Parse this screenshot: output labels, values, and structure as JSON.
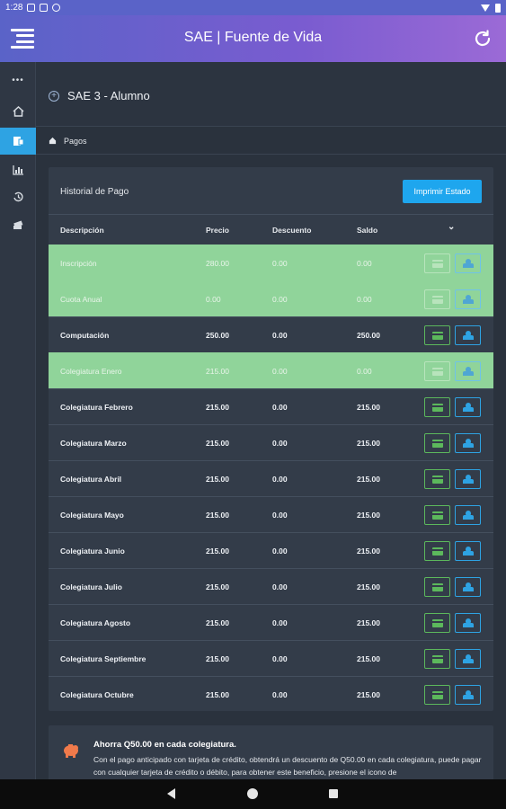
{
  "status": {
    "time": "1:28"
  },
  "app": {
    "title": "SAE | Fuente de Vida"
  },
  "sidebar": {
    "dots": "•••"
  },
  "page": {
    "title": "SAE 3 - Alumno",
    "breadcrumb": "Pagos"
  },
  "card": {
    "title": "Historial de Pago",
    "print_label": "Imprimir Estado",
    "columns": {
      "description": "Descripción",
      "price": "Precio",
      "discount": "Descuento",
      "balance": "Saldo",
      "expand": "⌄"
    },
    "rows": [
      {
        "description": "Inscripción",
        "price": "280.00",
        "discount": "0.00",
        "balance": "0.00",
        "paid": true
      },
      {
        "description": "Cuota Anual",
        "price": "0.00",
        "discount": "0.00",
        "balance": "0.00",
        "paid": true
      },
      {
        "description": "Computación",
        "price": "250.00",
        "discount": "0.00",
        "balance": "250.00",
        "paid": false
      },
      {
        "description": "Colegiatura Enero",
        "price": "215.00",
        "discount": "0.00",
        "balance": "0.00",
        "paid": true
      },
      {
        "description": "Colegiatura Febrero",
        "price": "215.00",
        "discount": "0.00",
        "balance": "215.00",
        "paid": false
      },
      {
        "description": "Colegiatura Marzo",
        "price": "215.00",
        "discount": "0.00",
        "balance": "215.00",
        "paid": false
      },
      {
        "description": "Colegiatura Abril",
        "price": "215.00",
        "discount": "0.00",
        "balance": "215.00",
        "paid": false
      },
      {
        "description": "Colegiatura Mayo",
        "price": "215.00",
        "discount": "0.00",
        "balance": "215.00",
        "paid": false
      },
      {
        "description": "Colegiatura Junio",
        "price": "215.00",
        "discount": "0.00",
        "balance": "215.00",
        "paid": false
      },
      {
        "description": "Colegiatura Julio",
        "price": "215.00",
        "discount": "0.00",
        "balance": "215.00",
        "paid": false
      },
      {
        "description": "Colegiatura Agosto",
        "price": "215.00",
        "discount": "0.00",
        "balance": "215.00",
        "paid": false
      },
      {
        "description": "Colegiatura Septiembre",
        "price": "215.00",
        "discount": "0.00",
        "balance": "215.00",
        "paid": false
      },
      {
        "description": "Colegiatura Octubre",
        "price": "215.00",
        "discount": "0.00",
        "balance": "215.00",
        "paid": false
      }
    ]
  },
  "info": {
    "title": "Ahorra Q50.00 en cada colegiatura.",
    "text": "Con el pago anticipado con tarjeta de crédito, obtendrá un descuento de Q50.00 en cada colegiatura, puede pagar con cualquier tarjeta de crédito o débito, para obtener este beneficio, presione el icono de"
  },
  "colors": {
    "accent": "#2ea3e3",
    "paid_row": "#90d49a",
    "header_gradient_start": "#5a63c8",
    "header_gradient_end": "#9b6ad6"
  }
}
